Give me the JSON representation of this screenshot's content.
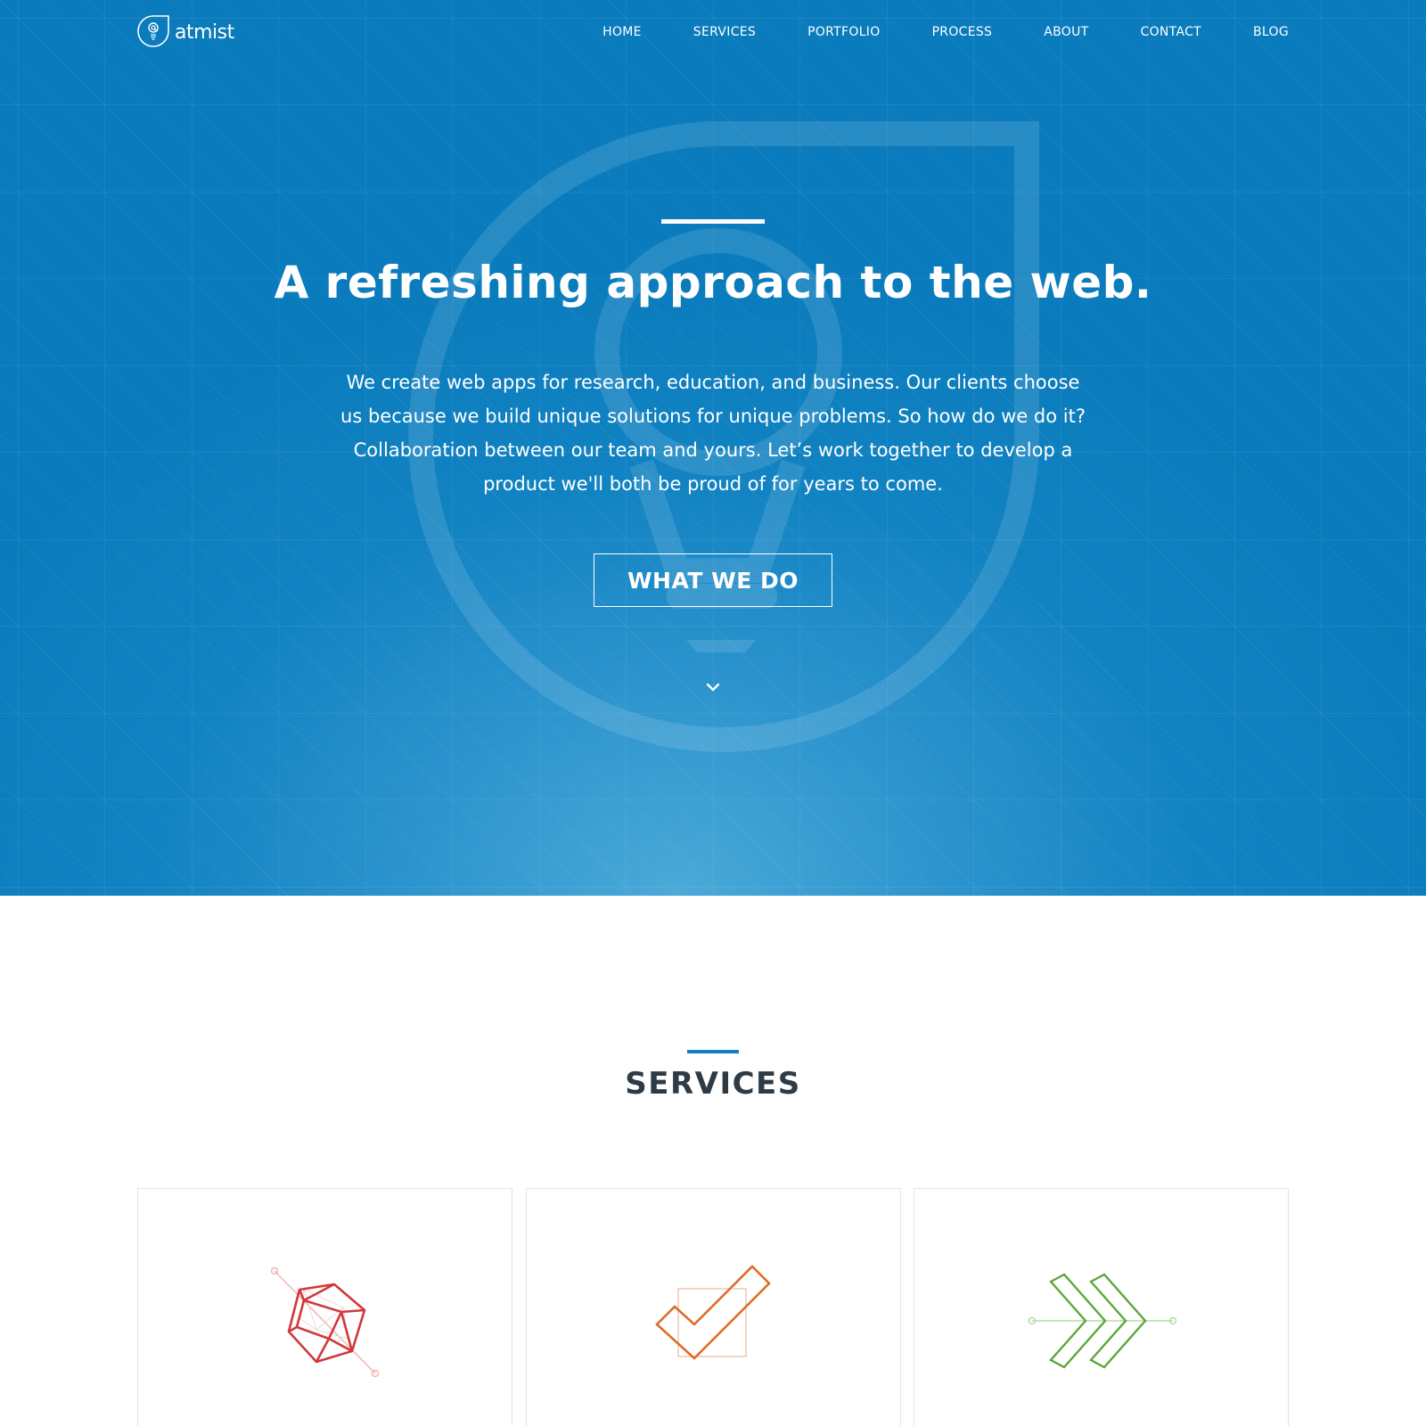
{
  "brand": {
    "name": "atmist"
  },
  "nav": {
    "items": [
      {
        "label": "HOME"
      },
      {
        "label": "SERVICES"
      },
      {
        "label": "PORTFOLIO"
      },
      {
        "label": "PROCESS"
      },
      {
        "label": "ABOUT"
      },
      {
        "label": "CONTACT"
      },
      {
        "label": "BLOG"
      }
    ]
  },
  "hero": {
    "title": "A refreshing approach to the web.",
    "description": "We create web apps for research, education, and business. Our clients choose us because we build unique solutions for unique problems. So how do we do it? Collaboration between our team and yours. Let’s work together to develop a product we'll both be proud of for years to come.",
    "cta_label": "WHAT WE DO",
    "scroll_icon": "chevron-down-icon"
  },
  "services": {
    "title": "SERVICES",
    "cards": [
      {
        "icon": "polyhedron-icon",
        "color": "#d0393b"
      },
      {
        "icon": "checkmark-icon",
        "color": "#e06a27"
      },
      {
        "icon": "fast-forward-arrows-icon",
        "color": "#5ba83a"
      }
    ]
  },
  "colors": {
    "hero_blue": "#0a7bbc",
    "accent_blue": "#0f7fbf",
    "heading_dark": "#2e3a44"
  }
}
